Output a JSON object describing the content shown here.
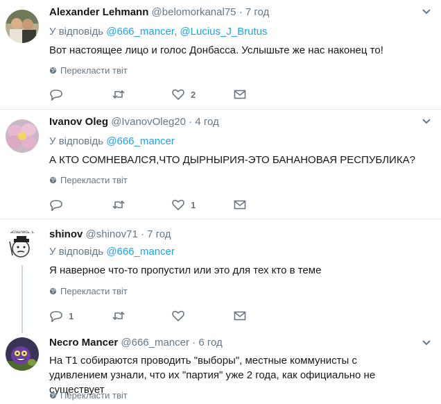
{
  "reply_prefix": "У відповідь",
  "translate_label": "Перекласти твіт",
  "tweets": [
    {
      "name": "Alexander Lehmann",
      "handle": "@belomorkanal75",
      "time": "7 год",
      "reply_to": [
        "@666_mancer",
        "@Lucius_J_Brutus"
      ],
      "text": "Вот настоящее лицо и голос Донбасса. Услышьте же нас наконец то!",
      "replies": "",
      "retweets": "",
      "likes": "2"
    },
    {
      "name": "Ivanov Oleg",
      "handle": "@IvanovOleg20",
      "time": "4 год",
      "reply_to": [
        "@666_mancer"
      ],
      "text": "А КТО СОМНЕВАЛСЯ,ЧТО ДЫРНЫРИЯ-ЭТО БАНАНОВАЯ РЕСПУБЛИКА?",
      "replies": "",
      "retweets": "",
      "likes": "1"
    },
    {
      "name": "shinov",
      "handle": "@shinov71",
      "time": "7 год",
      "reply_to": [
        "@666_mancer"
      ],
      "text": "Я наверное что-то пропустил или это для тех кто в теме",
      "replies": "1",
      "retweets": "",
      "likes": ""
    },
    {
      "name": "Necro Mancer",
      "handle": "@666_mancer",
      "time": "6 год",
      "text": "На Т1 собираются проводить \"выборы\", местные коммунисты с удивлением узнали, что их \"партия\" уже 2 года, как официально не существует"
    }
  ],
  "avatar3_caption": "Расошлись, Бл.",
  "colors": {
    "accent": "#1da1f2",
    "muted": "#657786",
    "text": "#14171a",
    "divider": "#e6ecf0"
  }
}
